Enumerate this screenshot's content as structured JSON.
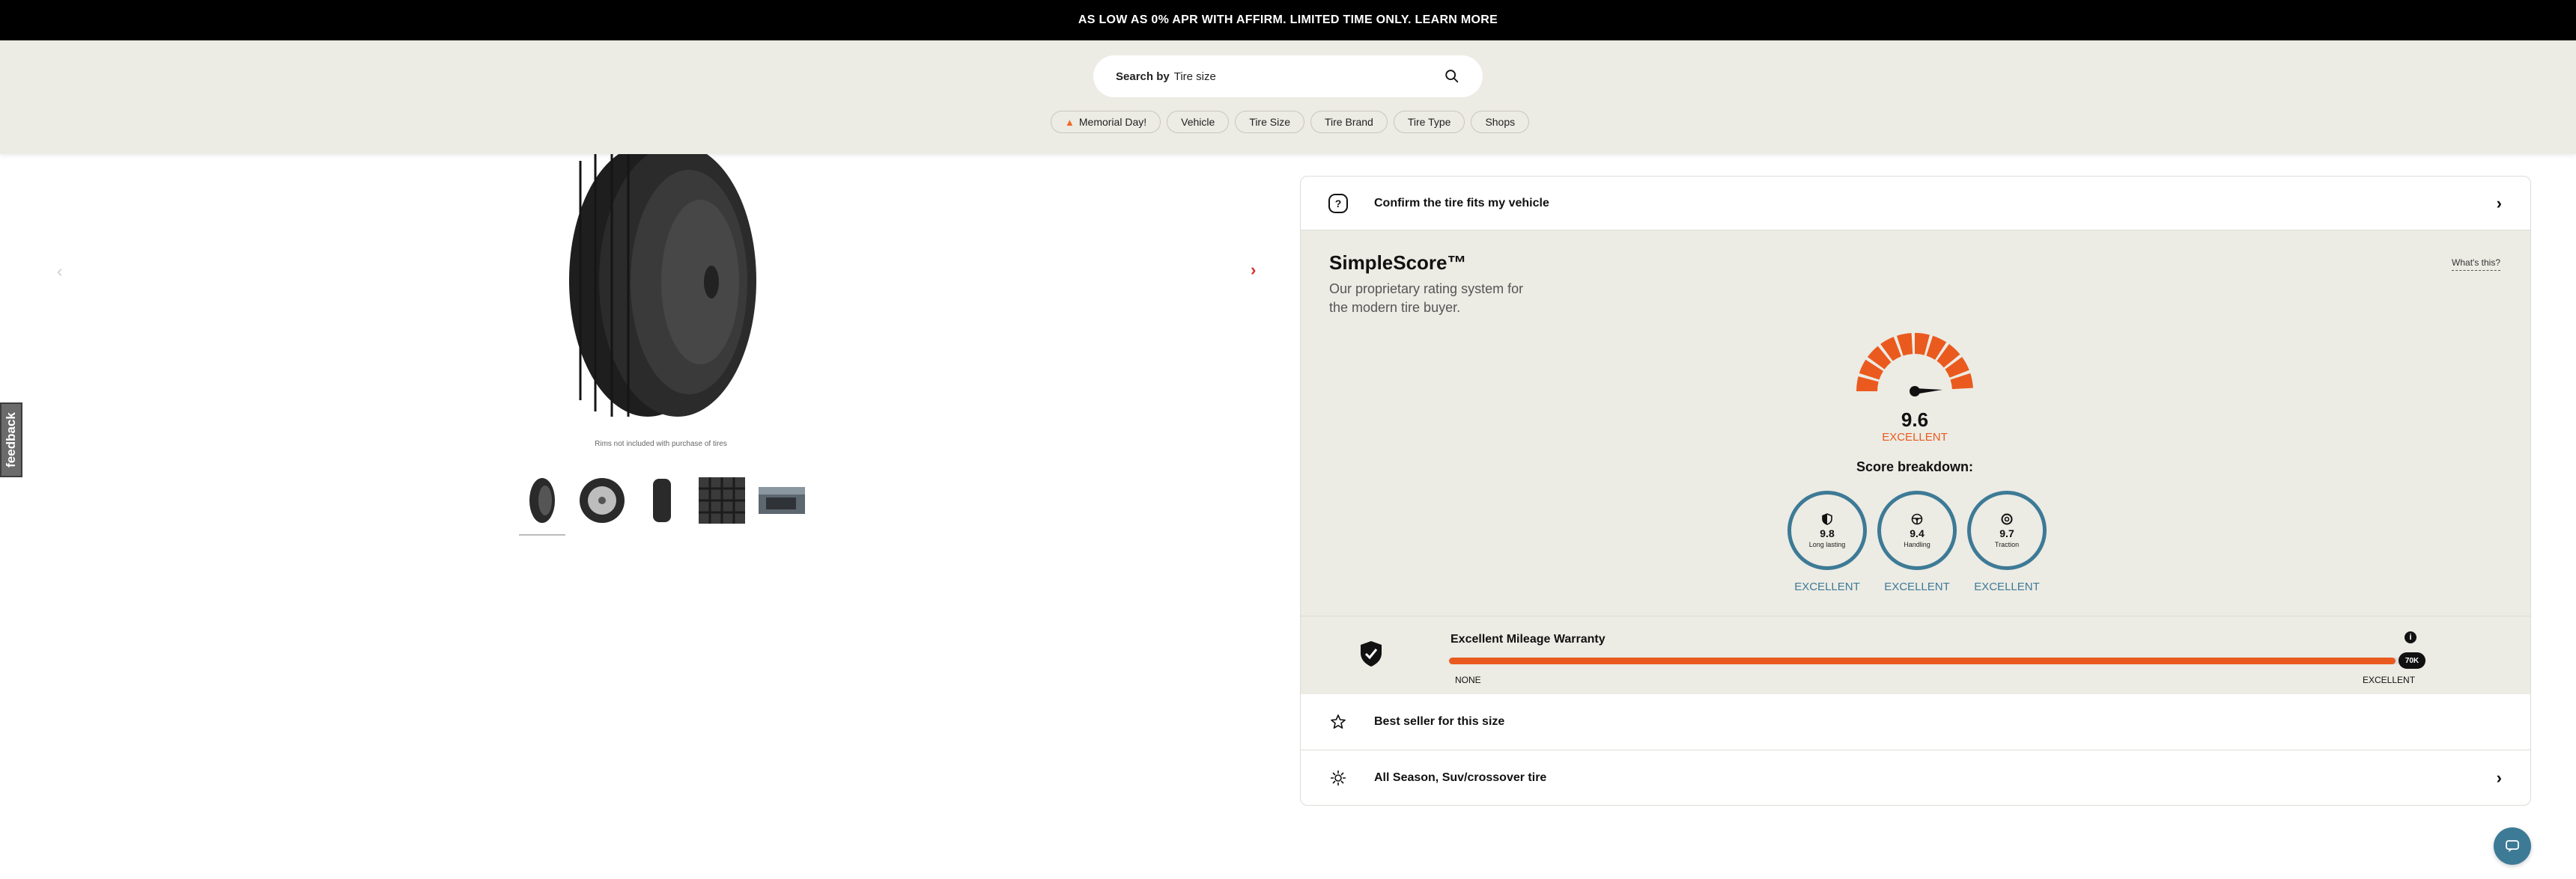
{
  "promo": {
    "text": "AS LOW AS 0% APR WITH AFFIRM. LIMITED TIME ONLY. LEARN MORE"
  },
  "search": {
    "prefix": "Search by",
    "placeholder": "Tire size",
    "icon": "search-icon"
  },
  "nav_pills": [
    {
      "label": "Memorial Day!",
      "icon": "flame-icon"
    },
    {
      "label": "Vehicle"
    },
    {
      "label": "Tire Size"
    },
    {
      "label": "Tire Brand"
    },
    {
      "label": "Tire Type"
    },
    {
      "label": "Shops"
    }
  ],
  "feedback": {
    "label": "feedback"
  },
  "gallery": {
    "rims_note": "Rims not included with purchase of tires",
    "thumbnails": [
      "tire-angle",
      "tire-side",
      "tire-front",
      "tread-closeup",
      "tire-lifestyle"
    ]
  },
  "product": {
    "confirm_label": "Confirm the tire fits my vehicle",
    "simplescore": {
      "title": "SimpleScore™",
      "whats_this": "What's this?",
      "subtitle": "Our proprietary rating system for the modern tire buyer.",
      "value": "9.6",
      "rating": "EXCELLENT",
      "breakdown_title": "Score breakdown:",
      "breakdown": [
        {
          "name": "Long lasting",
          "value": "9.8",
          "rating": "EXCELLENT",
          "icon": "shield-icon"
        },
        {
          "name": "Handling",
          "value": "9.4",
          "rating": "EXCELLENT",
          "icon": "steering-wheel-icon"
        },
        {
          "name": "Traction",
          "value": "9.7",
          "rating": "EXCELLENT",
          "icon": "tire-icon"
        }
      ]
    },
    "warranty": {
      "title": "Excellent Mileage Warranty",
      "knob_label": "70K",
      "min_label": "NONE",
      "max_label": "EXCELLENT",
      "fill_fraction": 0.98
    },
    "best_seller_label": "Best seller for this size",
    "season_label": "All Season, Suv/crossover tire"
  },
  "colors": {
    "accent_orange": "#ea5a1e",
    "score_blue": "#3d7a96",
    "panel_bg": "#ecebe4"
  }
}
